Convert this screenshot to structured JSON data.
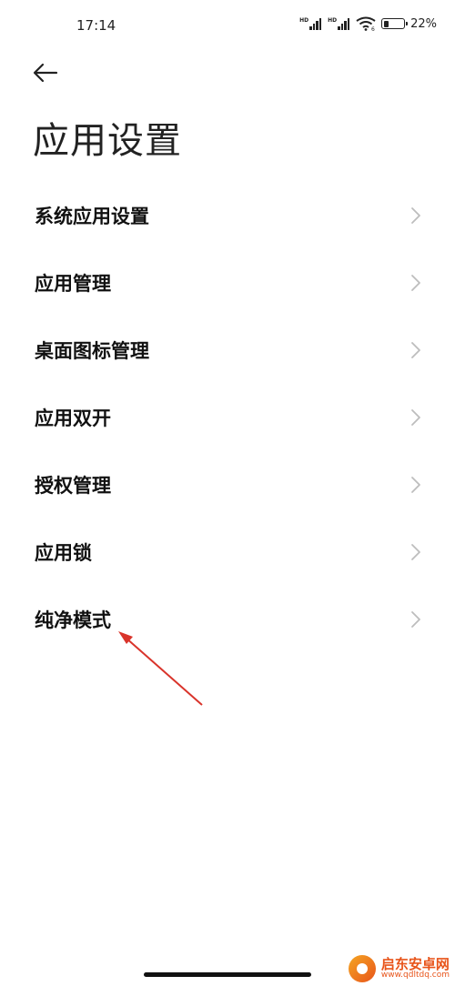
{
  "status_bar": {
    "time": "17:14",
    "signal_label": "HD",
    "battery_text": "22%",
    "battery_level": 0.22,
    "wifi_sub": "6"
  },
  "header": {
    "back_icon": "arrow-left-icon",
    "title": "应用设置"
  },
  "menu": {
    "items": [
      {
        "label": "系统应用设置"
      },
      {
        "label": "应用管理"
      },
      {
        "label": "桌面图标管理"
      },
      {
        "label": "应用双开"
      },
      {
        "label": "授权管理"
      },
      {
        "label": "应用锁"
      },
      {
        "label": "纯净模式"
      }
    ],
    "chevron_icon": "chevron-right-icon"
  },
  "annotation": {
    "color": "#d9342b",
    "icon": "red-arrow-annotation"
  },
  "watermark": {
    "name": "启东安卓网",
    "url": "www.qdltdq.com"
  }
}
